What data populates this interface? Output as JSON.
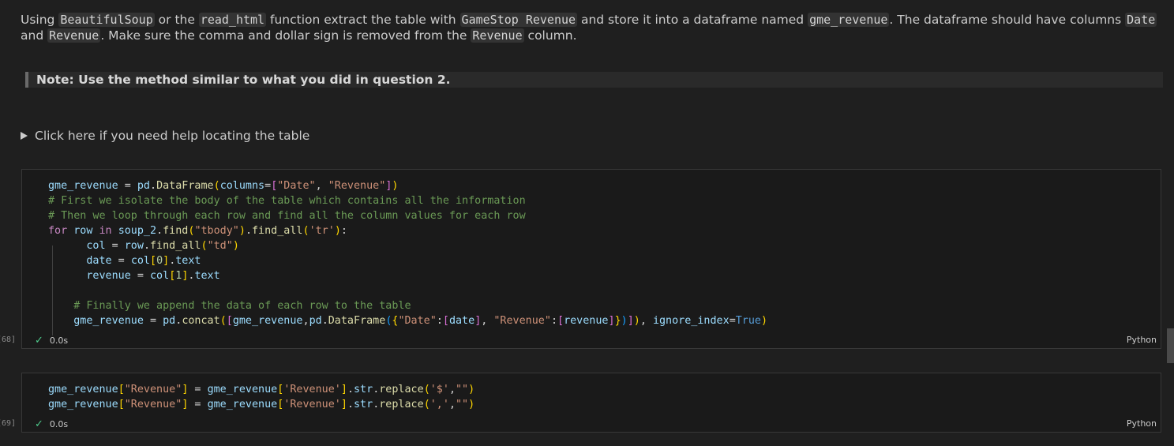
{
  "markdown": {
    "para_1": "Using ",
    "code_1": "BeautifulSoup",
    "para_2": " or the ",
    "code_2": "read_html",
    "para_3": " function extract the table with ",
    "code_3": "GameStop Revenue",
    "para_4": " and store it into a dataframe named ",
    "code_4": "gme_revenue",
    "para_5": ". The dataframe should have columns ",
    "code_5": "Date",
    "para_6": " and ",
    "code_6": "Revenue",
    "para_7": ". Make sure the comma and dollar sign is removed from the ",
    "code_7": "Revenue",
    "para_8": " column.",
    "note": "Note: Use the method similar to what you did in question 2.",
    "details_summary": "Click here if you need help locating the table"
  },
  "cells": [
    {
      "exec_count": "[68]",
      "status_time": "0.0s",
      "language": "Python"
    },
    {
      "exec_count": "[69]",
      "status_time": "0.0s",
      "language": "Python"
    }
  ],
  "colors": {
    "background": "#1f1f1f",
    "cell_background": "#1a1a1a",
    "success_check": "#4ec98b"
  },
  "icons": {
    "details_toggle": "triangle-right-icon",
    "status": "check-icon"
  }
}
